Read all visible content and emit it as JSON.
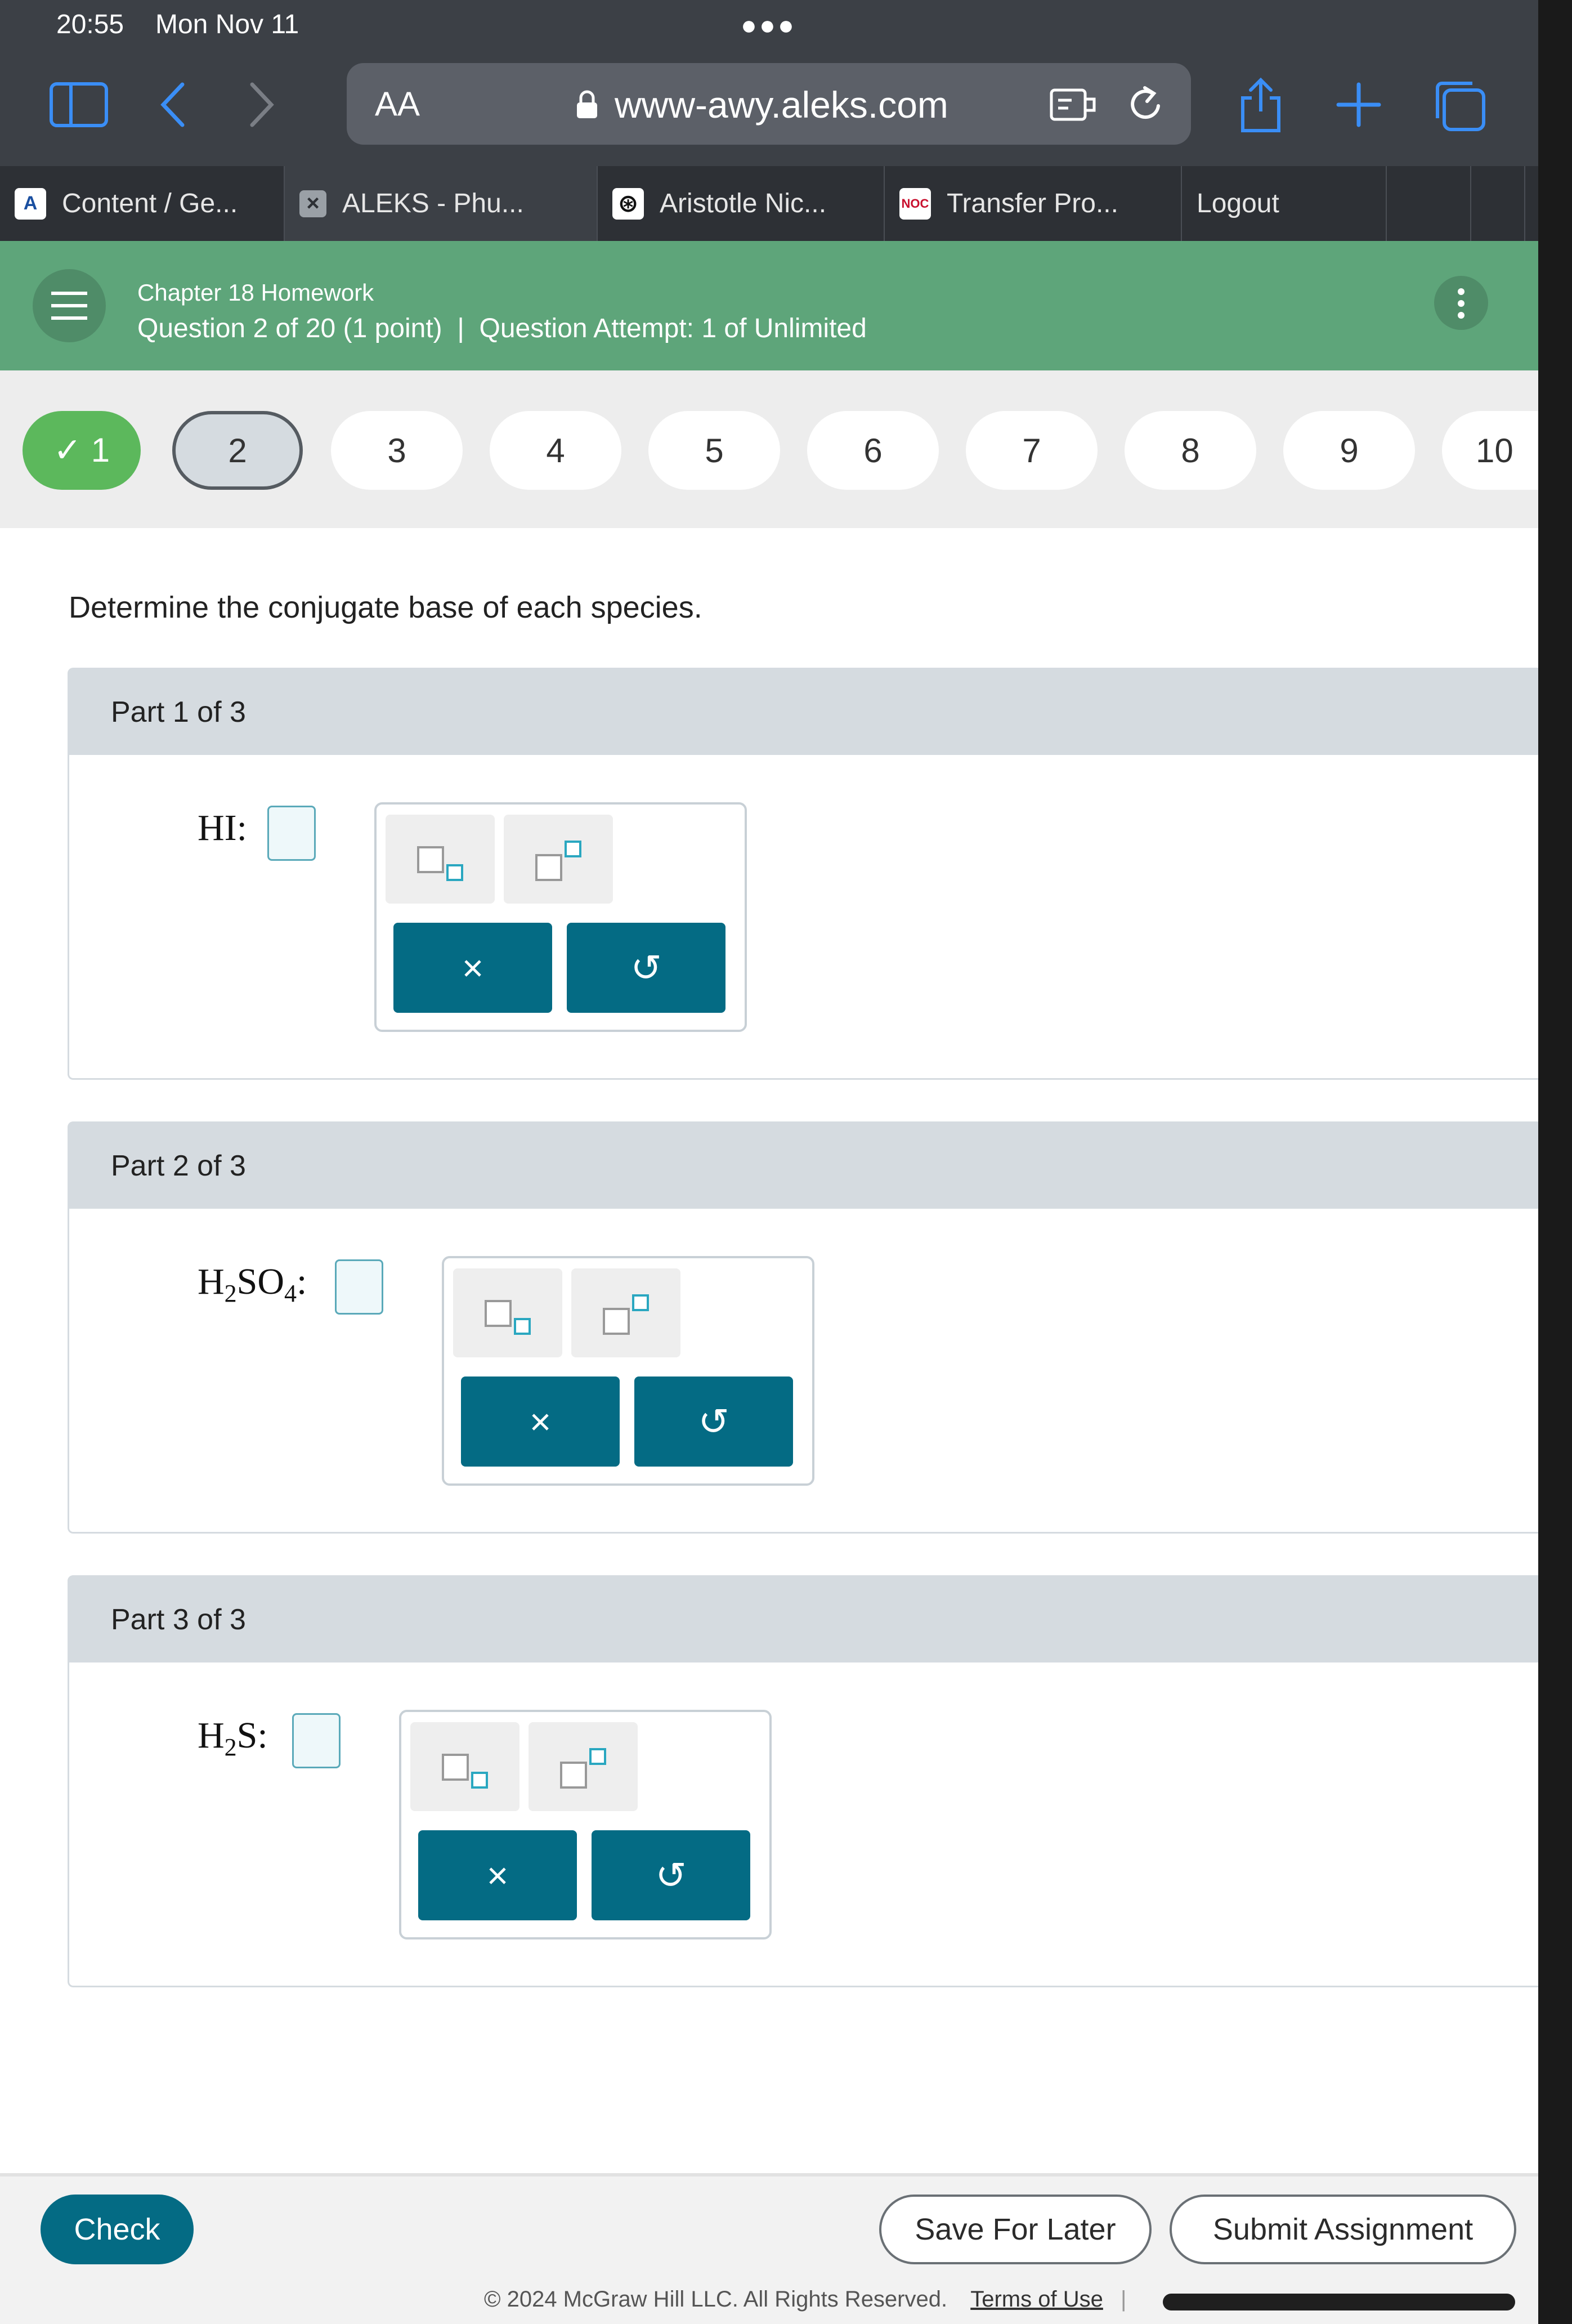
{
  "status_bar": {
    "time": "20:55",
    "date": "Mon Nov 11"
  },
  "address_bar": {
    "text_size": "AA",
    "url": "www-awy.aleks.com"
  },
  "tabs": [
    {
      "label": "Content / Ge...",
      "icon": "aleks-logo-icon",
      "icon_text": "A"
    },
    {
      "label": "ALEKS - Phu...",
      "icon": "close-icon",
      "icon_text": "×"
    },
    {
      "label": "Aristotle Nic...",
      "icon": "chatgpt-icon",
      "icon_text": "⊛"
    },
    {
      "label": "Transfer Pro...",
      "icon": "noc-logo-icon",
      "icon_text": "NOC"
    },
    {
      "label": "Logout"
    }
  ],
  "header": {
    "title": "Chapter 18 Homework",
    "subtitle": "Question 2 of 20 (1 point)  |  Question Attempt: 1 of Unlimited"
  },
  "question_nav": {
    "items": [
      "✓ 1",
      "2",
      "3",
      "4",
      "5",
      "6",
      "7",
      "8",
      "9",
      "10"
    ],
    "current": 2
  },
  "prompt": "Determine the conjugate base of each species.",
  "parts": [
    {
      "heading": "Part 1 of 3",
      "species": "HI",
      "colon": ":"
    },
    {
      "heading": "Part 2 of 3",
      "species_parts": [
        "H",
        "2",
        "SO",
        "4"
      ],
      "colon": ":"
    },
    {
      "heading": "Part 3 of 3",
      "species_parts": [
        "H",
        "2",
        "S"
      ],
      "colon": ":"
    }
  ],
  "palette": {
    "clear": "×",
    "undo": "↺"
  },
  "footer": {
    "check": "Check",
    "save": "Save For Later",
    "submit": "Submit Assignment",
    "copyright": "© 2024 McGraw Hill LLC. All Rights Reserved.",
    "terms": "Terms of Use"
  },
  "colors": {
    "header_green": "#5ea57a",
    "teal_button": "#046b84",
    "check_button": "#046b84",
    "answered_green": "#5cb85c"
  }
}
